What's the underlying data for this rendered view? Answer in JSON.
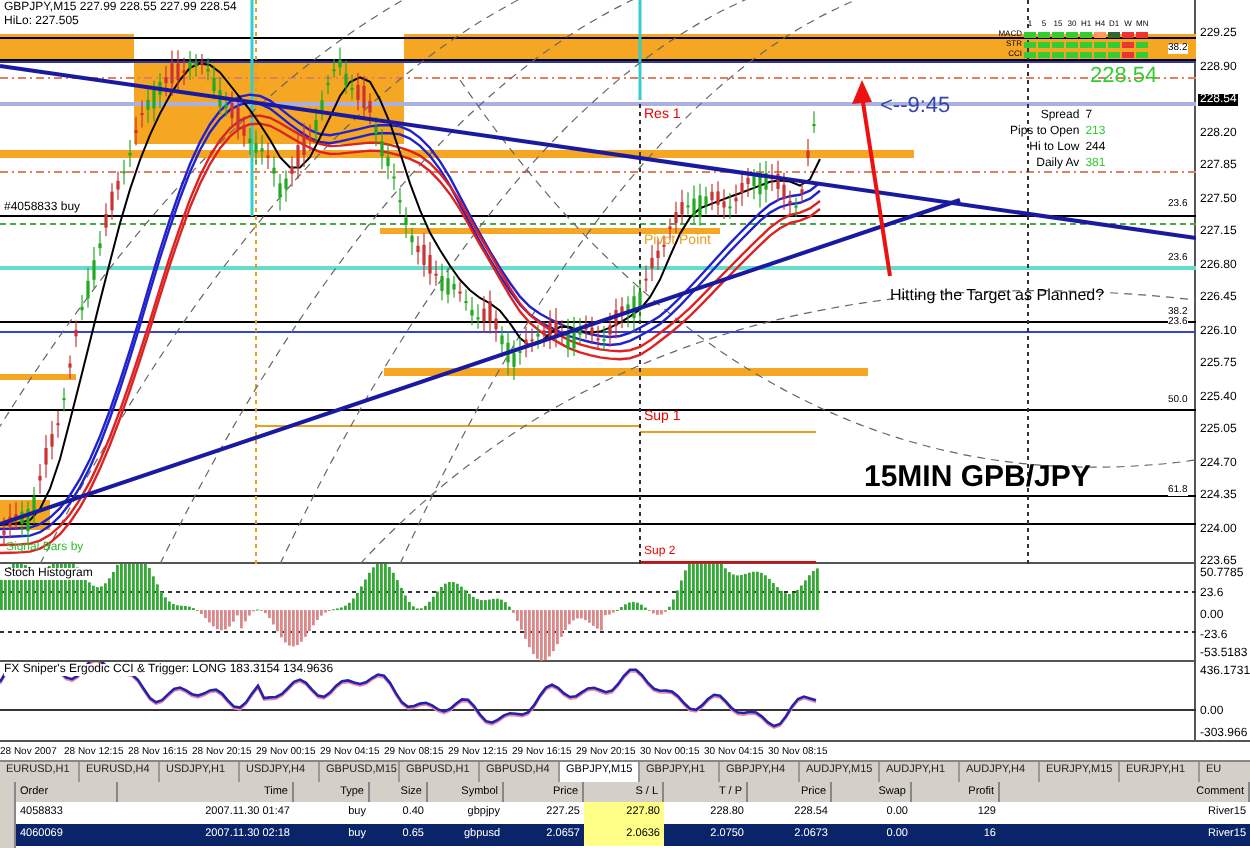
{
  "chart": {
    "symbol_line": "GBPJPY,M15  227.99 228.55 227.99 228.54",
    "hilo": "HiLo: 227.505",
    "annotations": [
      "Res 1",
      "<--9:45",
      "Pivot Point",
      "Sup 1",
      "Sup 2",
      "#4058833 buy",
      "Signal Bars by",
      "Hitting the Target as Planned?",
      "15MIN GPB/JPY"
    ],
    "fib_levels": [
      "38.2",
      "23.6",
      "23.6",
      "38.2",
      "23.6",
      "50.0",
      "61.8"
    ],
    "signal_table": {
      "headers": [
        "1",
        "5",
        "15",
        "30",
        "H1",
        "H4",
        "D1",
        "W",
        "MN"
      ],
      "rows": [
        {
          "label": "MACD",
          "cells": [
            {
              "color": "#33cc33"
            },
            {
              "color": "#33cc33"
            },
            {
              "color": "#33cc33"
            },
            {
              "color": "#33cc33"
            },
            {
              "color": "#33cc33"
            },
            {
              "color": "#ff9966"
            },
            {
              "color": "#336633"
            },
            {
              "color": "#ee3333"
            },
            {
              "color": "#ee3333"
            }
          ]
        },
        {
          "label": "STR",
          "cells": [
            {
              "color": "#33cc33"
            },
            {
              "color": "#33cc33"
            },
            {
              "color": "#33cc33"
            },
            {
              "color": "#33cc33"
            },
            {
              "color": "#33cc33"
            },
            {
              "color": "#33cc33"
            },
            {
              "color": "#33cc33"
            },
            {
              "color": "#ee3333"
            },
            {
              "color": "#33cc33"
            }
          ]
        },
        {
          "label": "CCI",
          "cells": [
            {
              "color": "#33cc33"
            },
            {
              "color": "#33cc33"
            },
            {
              "color": "#33cc33"
            },
            {
              "color": "#33cc33"
            },
            {
              "color": "#33cc33"
            },
            {
              "color": "#33cc33"
            },
            {
              "color": "#33cc33"
            },
            {
              "color": "#ee3333"
            },
            {
              "color": "#33cc33"
            }
          ]
        }
      ]
    },
    "info": {
      "price": "228.54",
      "rows": [
        {
          "label": "Spread",
          "value": "7"
        },
        {
          "label": "Pips to Open",
          "value": "213",
          "color": "#33cc33"
        },
        {
          "label": "Hi to Low",
          "value": "244"
        },
        {
          "label": "Daily Av",
          "value": "381",
          "color": "#33cc33"
        }
      ]
    },
    "price_axis": [
      {
        "text": "229.25",
        "highlighted": false
      },
      {
        "text": "228.90",
        "highlighted": false
      },
      {
        "text": "228.54",
        "highlighted": true
      },
      {
        "text": "228.20",
        "highlighted": false
      },
      {
        "text": "227.85",
        "highlighted": false
      },
      {
        "text": "227.50",
        "highlighted": false
      },
      {
        "text": "227.15",
        "highlighted": false
      },
      {
        "text": "226.80",
        "highlighted": false
      },
      {
        "text": "226.45",
        "highlighted": false
      },
      {
        "text": "226.10",
        "highlighted": false
      },
      {
        "text": "225.75",
        "highlighted": false
      },
      {
        "text": "225.40",
        "highlighted": false
      },
      {
        "text": "225.05",
        "highlighted": false
      },
      {
        "text": "224.70",
        "highlighted": false
      },
      {
        "text": "224.35",
        "highlighted": false
      },
      {
        "text": "224.00",
        "highlighted": false
      },
      {
        "text": "223.65",
        "highlighted": false
      }
    ]
  },
  "stoch": {
    "title": "Stoch Histogram",
    "axis": [
      "50.7785",
      "23.6",
      "0.00",
      "-23.6",
      "-53.5183"
    ]
  },
  "cci": {
    "title": "FX Sniper's Ergodic CCI & Trigger: LONG 183.3154 134.9636",
    "axis": [
      "436.1731",
      "0.00",
      "-303.966"
    ]
  },
  "time_axis": [
    "28 Nov 2007",
    "28 Nov 12:15",
    "28 Nov 16:15",
    "28 Nov 20:15",
    "29 Nov 00:15",
    "29 Nov 04:15",
    "29 Nov 08:15",
    "29 Nov 12:15",
    "29 Nov 16:15",
    "29 Nov 20:15",
    "30 Nov 00:15",
    "30 Nov 04:15",
    "30 Nov 08:15"
  ],
  "tabs": [
    {
      "label": "EURUSD,H1",
      "selected": false
    },
    {
      "label": "EURUSD,H4",
      "selected": false
    },
    {
      "label": "USDJPY,H1",
      "selected": false
    },
    {
      "label": "USDJPY,H4",
      "selected": false
    },
    {
      "label": "GBPUSD,M15",
      "selected": false
    },
    {
      "label": "GBPUSD,H1",
      "selected": false
    },
    {
      "label": "GBPUSD,H4",
      "selected": false
    },
    {
      "label": "GBPJPY,M15",
      "selected": true
    },
    {
      "label": "GBPJPY,H1",
      "selected": false
    },
    {
      "label": "GBPJPY,H4",
      "selected": false
    },
    {
      "label": "AUDJPY,M15",
      "selected": false
    },
    {
      "label": "AUDJPY,H1",
      "selected": false
    },
    {
      "label": "AUDJPY,H4",
      "selected": false
    },
    {
      "label": "EURJPY,M15",
      "selected": false
    },
    {
      "label": "EURJPY,H1",
      "selected": false
    },
    {
      "label": "EU",
      "selected": false
    }
  ],
  "orders": {
    "columns": [
      "Order",
      "Time",
      "Type",
      "Size",
      "Symbol",
      "Price",
      "S / L",
      "T / P",
      "Price",
      "Swap",
      "Profit",
      "Comment"
    ],
    "rows": [
      {
        "selected": false,
        "cells": [
          "4058833",
          "2007.11.30 01:47",
          "buy",
          "0.40",
          "gbpjpy",
          "227.25",
          "227.80",
          "228.80",
          "228.54",
          "0.00",
          "129",
          "River15"
        ]
      },
      {
        "selected": true,
        "cells": [
          "4060069",
          "2007.11.30 02:18",
          "buy",
          "0.65",
          "gbpusd",
          "2.0657",
          "2.0636",
          "2.0750",
          "2.0673",
          "0.00",
          "16",
          "River15"
        ]
      }
    ]
  }
}
